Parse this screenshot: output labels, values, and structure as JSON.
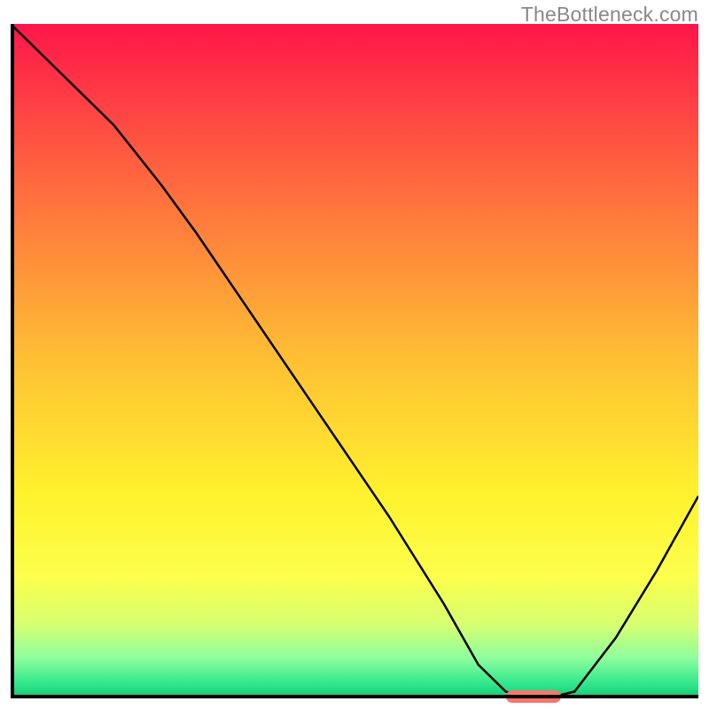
{
  "watermark": "TheBottleneck.com",
  "chart_data": {
    "type": "line",
    "title": "",
    "xlabel": "",
    "ylabel": "",
    "xlim": [
      0,
      100
    ],
    "ylim": [
      0,
      100
    ],
    "grid": false,
    "legend": false,
    "background_gradient": {
      "direction": "vertical",
      "stops": [
        {
          "pos": 0,
          "color": "#ff1649"
        },
        {
          "pos": 25,
          "color": "#ff6e3e"
        },
        {
          "pos": 50,
          "color": "#ffc034"
        },
        {
          "pos": 70,
          "color": "#fff22e"
        },
        {
          "pos": 82,
          "color": "#fcff4c"
        },
        {
          "pos": 89,
          "color": "#d7ff71"
        },
        {
          "pos": 94,
          "color": "#8eff9d"
        },
        {
          "pos": 98,
          "color": "#2ee58b"
        },
        {
          "pos": 100,
          "color": "#13c672"
        }
      ]
    },
    "series": [
      {
        "name": "bottleneck-curve",
        "color": "#000000",
        "width": 2.5,
        "x": [
          0,
          8,
          15,
          22,
          27,
          35,
          45,
          55,
          63,
          68,
          72,
          75,
          78,
          82,
          88,
          94,
          100
        ],
        "y": [
          100,
          92,
          85,
          76,
          69,
          57,
          42,
          27,
          14,
          5,
          1,
          0,
          0,
          1,
          9,
          19,
          30
        ]
      }
    ],
    "marker": {
      "name": "optimal-range",
      "color": "#f9746c",
      "x_start": 72,
      "x_end": 80,
      "y": 0,
      "height": 1.8
    },
    "annotations": []
  }
}
